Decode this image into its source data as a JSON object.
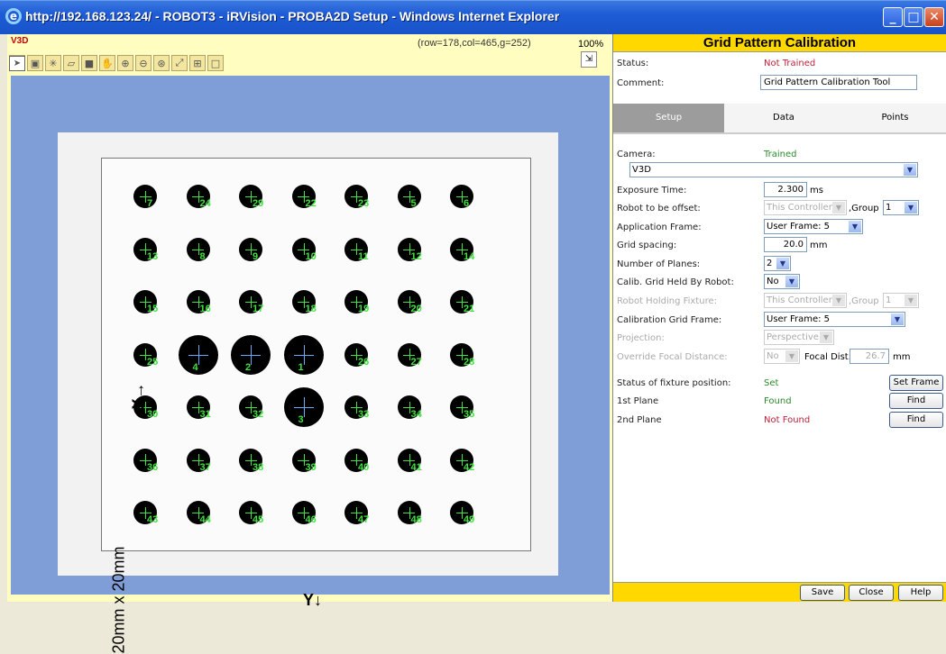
{
  "window": {
    "title": "http://192.168.123.24/ - ROBOT3 - iRVision - PROBA2D Setup - Windows Internet Explorer",
    "min": "_",
    "max": "□",
    "close": "✕"
  },
  "viewer": {
    "title": "V3D",
    "coords": "(row=178,col=465,g=252)",
    "zoom": "100%"
  },
  "image": {
    "axis_x": "X",
    "axis_y": "Y",
    "grid_label": "20mm x 20mm",
    "dots": [
      [
        "7",
        "24",
        "29",
        "22",
        "23",
        "5",
        "6"
      ],
      [
        "13",
        "8",
        "9",
        "10",
        "11",
        "12",
        "14"
      ],
      [
        "15",
        "16",
        "17",
        "18",
        "19",
        "20",
        "21"
      ],
      [
        "25",
        "4",
        "2",
        "1",
        "26",
        "27",
        "28"
      ],
      [
        "30",
        "31",
        "32",
        "3",
        "33",
        "34",
        "35"
      ],
      [
        "36",
        "37",
        "38",
        "39",
        "40",
        "41",
        "42"
      ],
      [
        "43",
        "44",
        "45",
        "46",
        "47",
        "48",
        "49"
      ]
    ]
  },
  "panel": {
    "title": "Grid Pattern Calibration",
    "status_label": "Status:",
    "status_value": "Not Trained",
    "comment_label": "Comment:",
    "comment_value": "Grid Pattern Calibration Tool",
    "tabs": [
      "Setup",
      "Data",
      "Points"
    ],
    "camera_label": "Camera:",
    "camera_status": "Trained",
    "camera_value": "V3D",
    "exposure_label": "Exposure Time:",
    "exposure_value": "2.300",
    "exposure_unit": "ms",
    "robot_offset_label": "Robot to be offset:",
    "robot_offset_value": "This Controller",
    "group_label": ",Group",
    "group_value": "1",
    "app_frame_label": "Application Frame:",
    "app_frame_value": "User Frame:  5",
    "grid_spacing_label": "Grid spacing:",
    "grid_spacing_value": "20.0",
    "grid_spacing_unit": "mm",
    "planes_label": "Number of Planes:",
    "planes_value": "2",
    "held_label": "Calib. Grid Held By Robot:",
    "held_value": "No",
    "holding_label": "Robot Holding Fixture:",
    "holding_value": "This Controller",
    "holding_group_label": ",Group",
    "holding_group_value": "1",
    "cal_frame_label": "Calibration Grid Frame:",
    "cal_frame_value": "User Frame:  5",
    "projection_label": "Projection:",
    "projection_value": "Perspective",
    "override_label": "Override Focal Distance:",
    "override_value": "No",
    "focal_label": "Focal Dist.:",
    "focal_value": "26.7",
    "focal_unit": "mm",
    "fixture_label": "Status of fixture position:",
    "fixture_value": "Set",
    "set_frame": "Set Frame",
    "plane1_label": "1st Plane",
    "plane1_value": "Found",
    "find1": "Find",
    "plane2_label": "2nd Plane",
    "plane2_value": "Not Found",
    "find2": "Find",
    "footer": {
      "save": "Save",
      "close": "Close",
      "help": "Help"
    }
  }
}
